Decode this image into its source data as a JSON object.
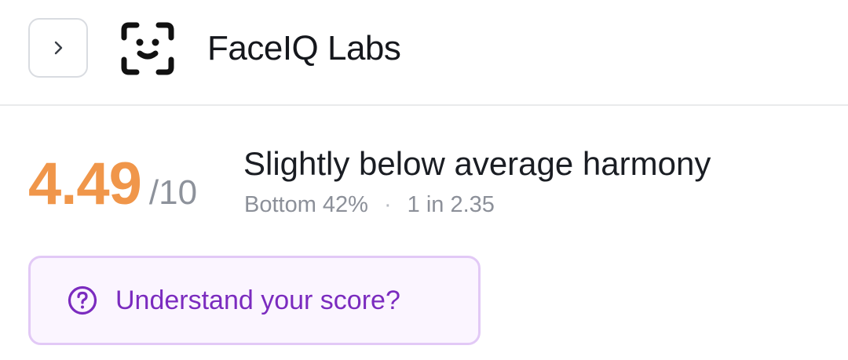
{
  "header": {
    "brand": "FaceIQ Labs",
    "toggle_icon": "chevron-right-icon",
    "logo_icon": "face-scan-icon"
  },
  "score": {
    "value": "4.49",
    "max": "/10",
    "headline": "Slightly below average harmony",
    "percentile": "Bottom 42%",
    "separator": "·",
    "ratio": "1 in 2.35"
  },
  "help": {
    "label": "Understand your score?",
    "icon": "question-circle-icon"
  },
  "colors": {
    "score_accent": "#f0964a",
    "help_text": "#7b2bbf",
    "help_border": "#e2c9f6",
    "help_background": "#fbf5ff"
  }
}
